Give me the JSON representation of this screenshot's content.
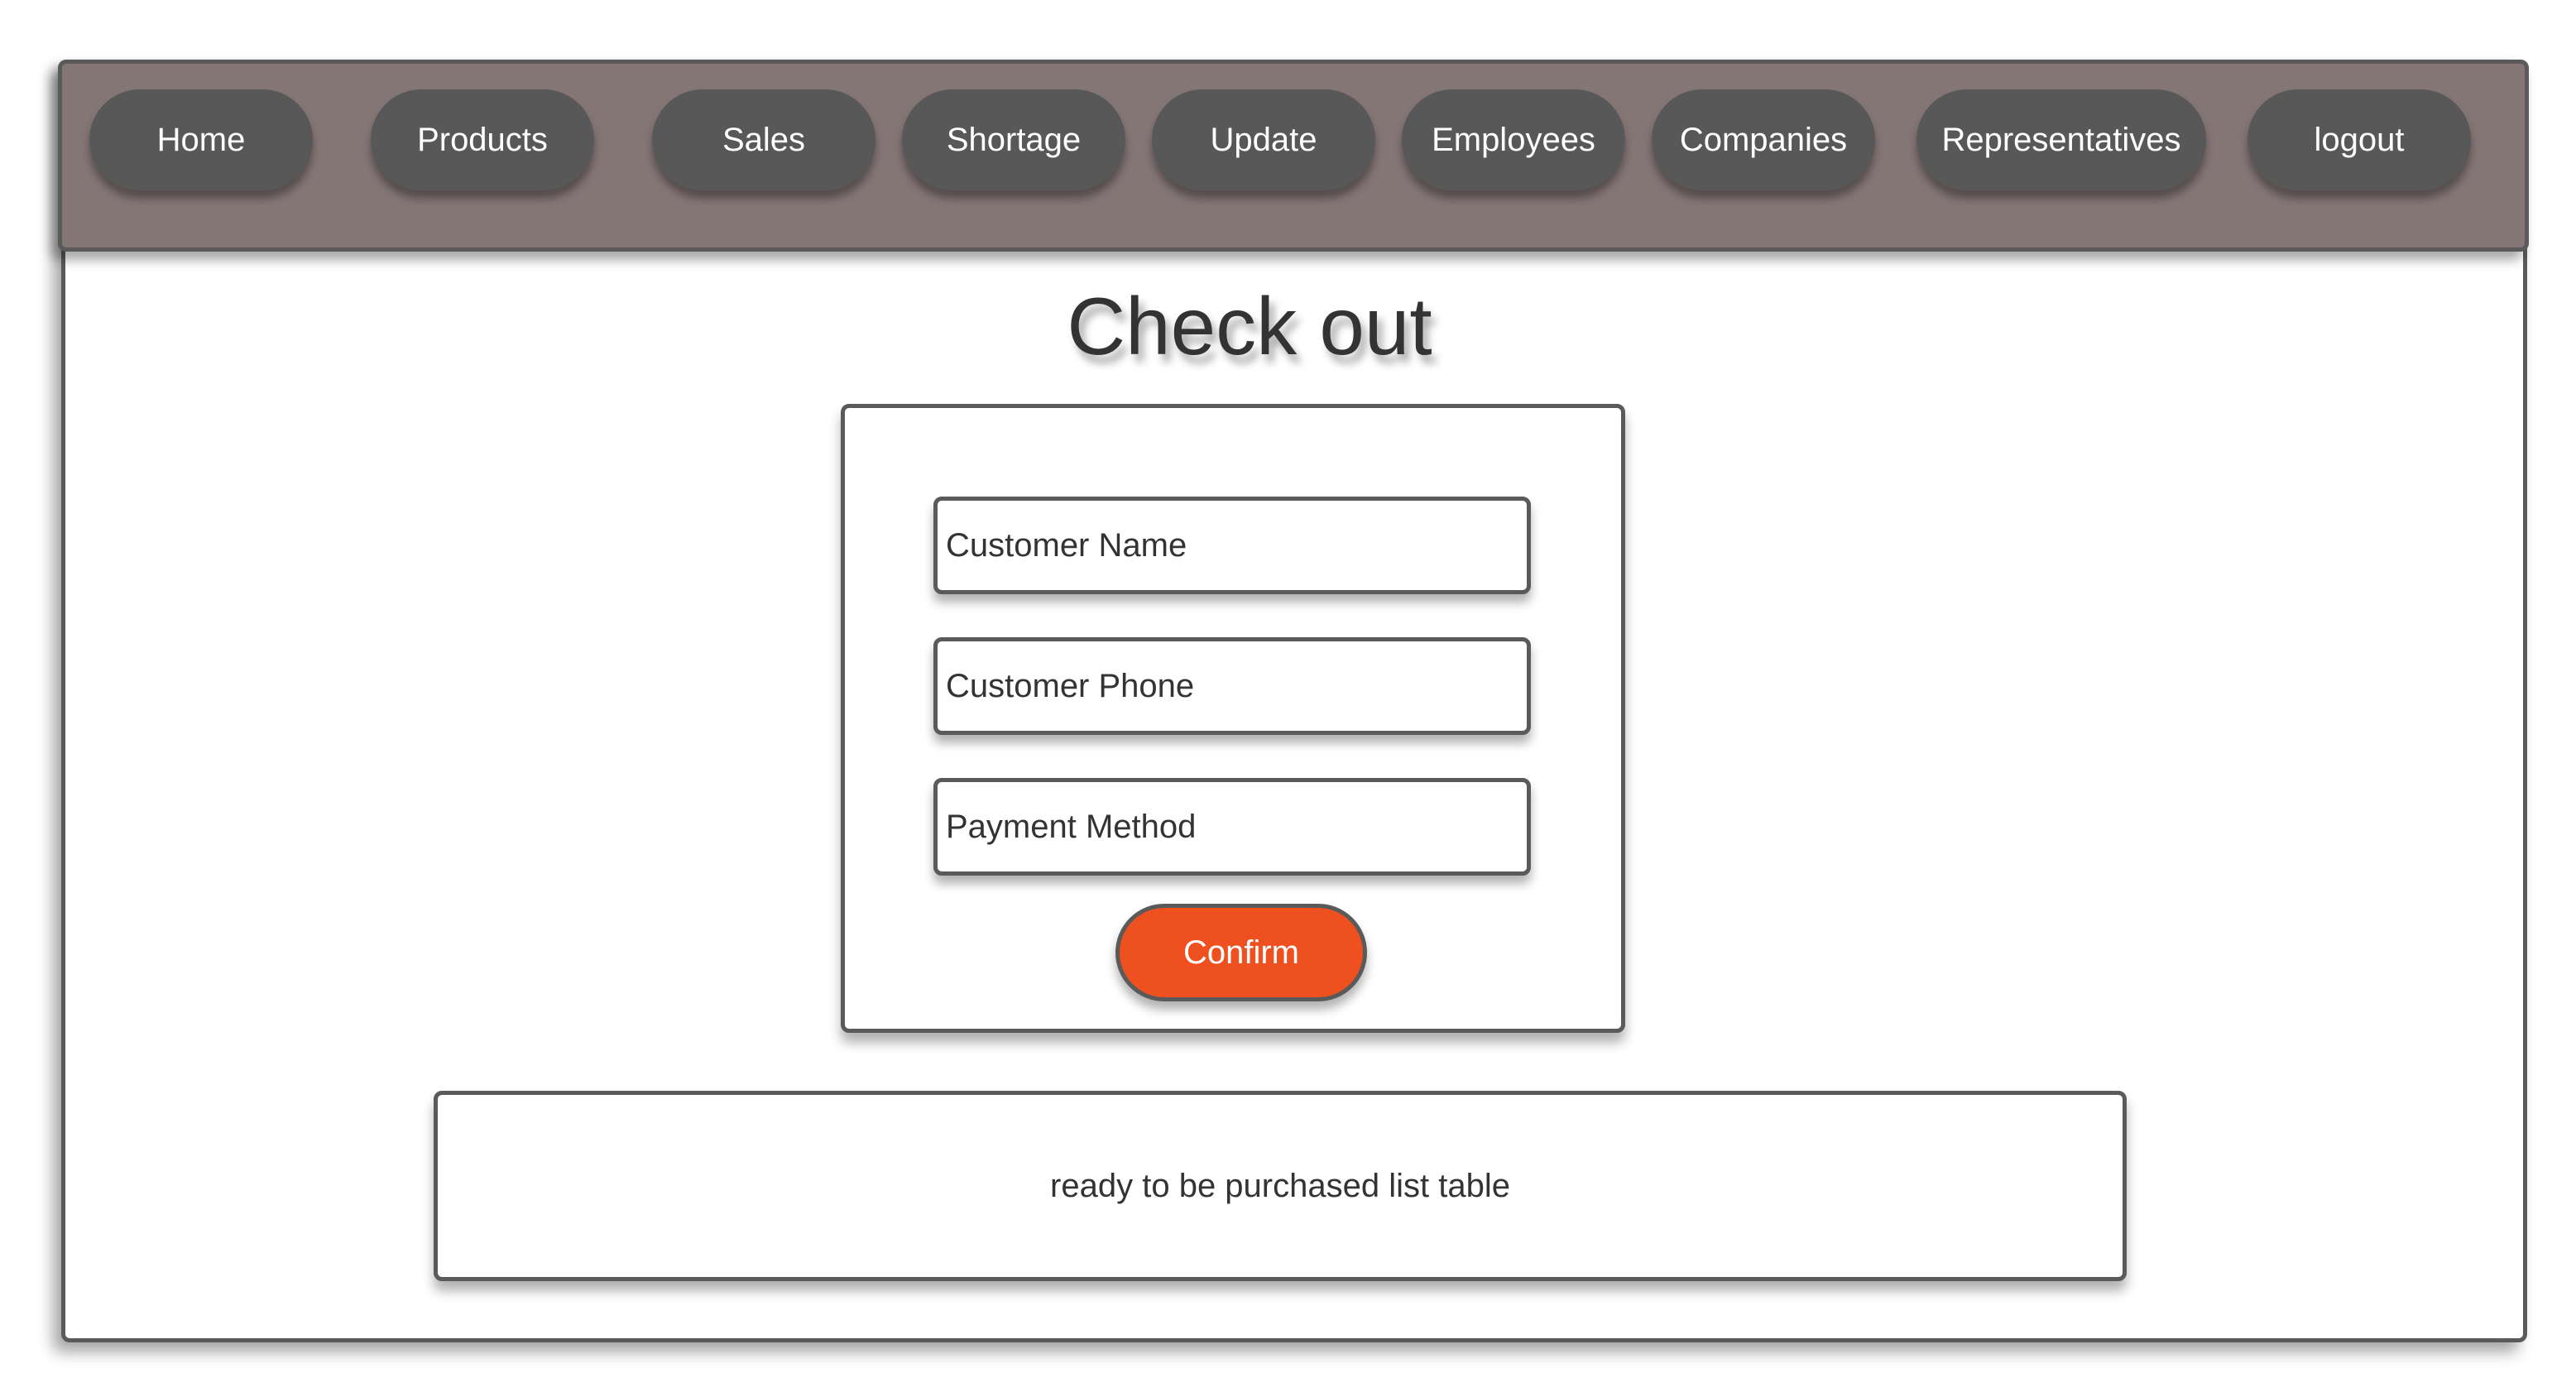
{
  "nav": {
    "items": [
      {
        "label": "Home"
      },
      {
        "label": "Products"
      },
      {
        "label": "Sales"
      },
      {
        "label": "Shortage"
      },
      {
        "label": "Update"
      },
      {
        "label": "Employees"
      },
      {
        "label": "Companies"
      },
      {
        "label": "Representatives"
      },
      {
        "label": "logout"
      }
    ]
  },
  "page": {
    "title": "Check out"
  },
  "form": {
    "customer_name_placeholder": "Customer Name",
    "customer_phone_placeholder": "Customer Phone",
    "payment_method_placeholder": "Payment Method",
    "confirm_label": "Confirm"
  },
  "purchase_table": {
    "placeholder_text": "ready to be purchased list table"
  },
  "colors": {
    "navbar_bg": "#857676",
    "nav_button_bg": "#585858",
    "confirm_bg": "#ee5020",
    "border": "#5a5a5a"
  }
}
